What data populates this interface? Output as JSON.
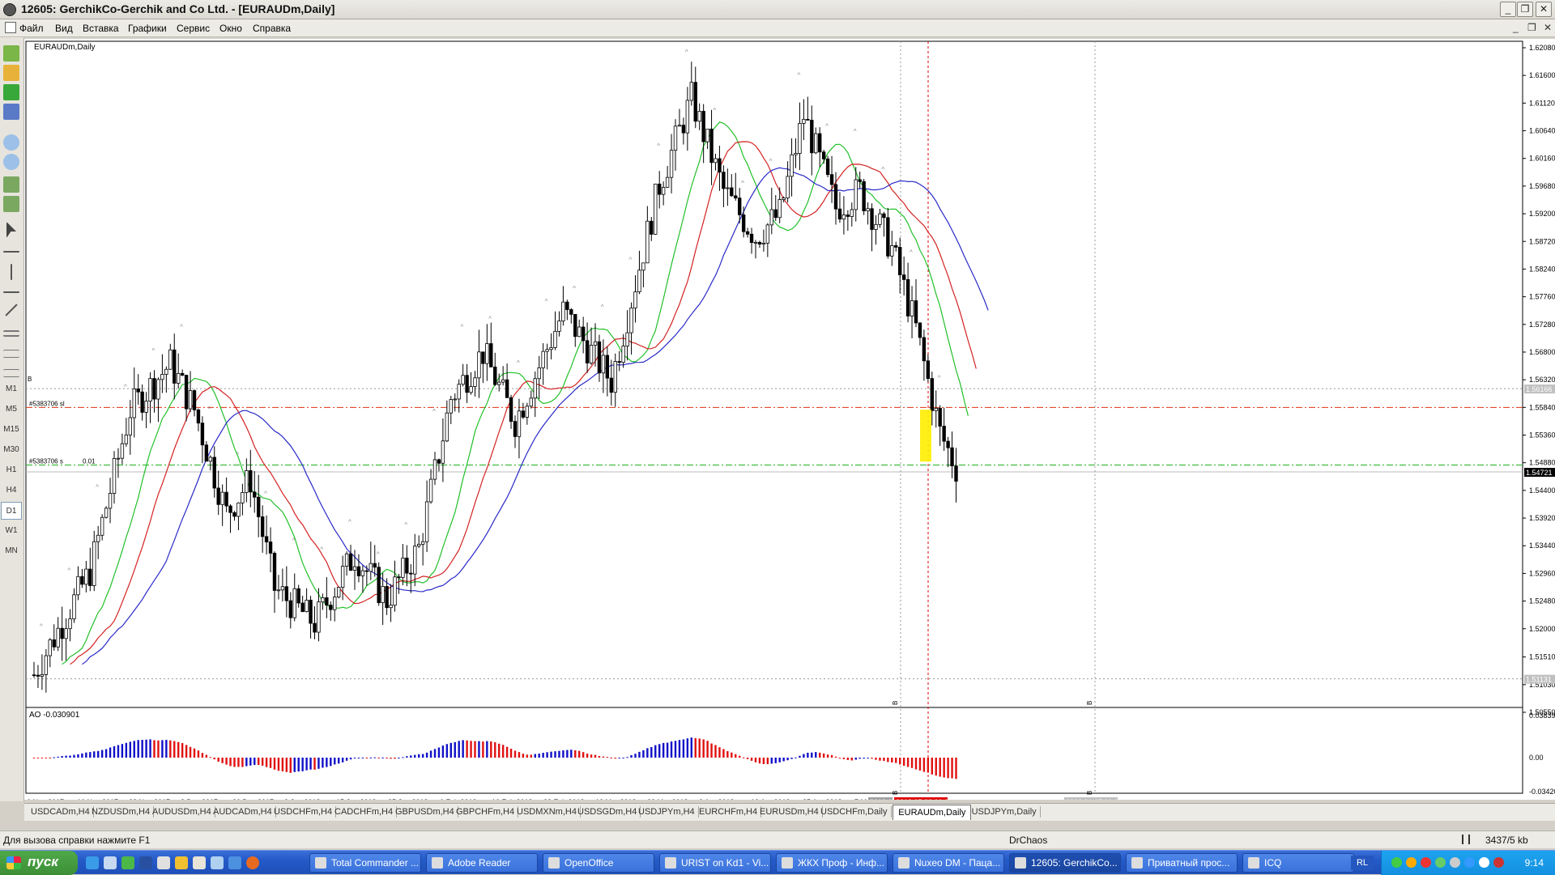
{
  "window": {
    "title": "12605: GerchikCo-Gerchik and Co Ltd. - [EURAUDm,Daily]",
    "min": "_",
    "max": "❐",
    "close": "✕"
  },
  "menu": [
    "Файл",
    "Вид",
    "Вставка",
    "Графики",
    "Сервис",
    "Окно",
    "Справка"
  ],
  "timeframes": [
    "M1",
    "M5",
    "M15",
    "M30",
    "H1",
    "H4",
    "D1",
    "W1",
    "MN"
  ],
  "active_timeframe": "D1",
  "chart": {
    "symbol_label": "EURAUDm,Daily",
    "price_ticks": [
      "1.62080",
      "1.61600",
      "1.61120",
      "1.60640",
      "1.60160",
      "1.59680",
      "1.59200",
      "1.58720",
      "1.58240",
      "1.57760",
      "1.57280",
      "1.56800",
      "1.56320",
      "1.55840",
      "1.55360",
      "1.54880",
      "1.54400",
      "1.53920",
      "1.53440",
      "1.52960",
      "1.52480",
      "1.52000",
      "1.51510",
      "1.51030",
      "1.50550"
    ],
    "price_min": 1.5055,
    "price_max": 1.6208,
    "bid_label": "1.54721",
    "level_label_upper": "1.56166",
    "level_label_lower": "1.51131",
    "order_label_1": "#5383706 sl",
    "order_label_2": "#5383706 s",
    "order_lot": "0.01",
    "order_marker": "B",
    "vline_marker": "B",
    "date_ticks": [
      "6 Nov 2017",
      "16 Nov 2017",
      "28 Nov 2017",
      "8 Dec 2017",
      "20 Dec 2017",
      "3 Jan 2018",
      "15 Jan 2018",
      "25 Jan 2018",
      "6 Feb 2018",
      "16 Feb 2018",
      "28 Feb 2018",
      "12 Mar 2018",
      "22 Mar 2018",
      "3 Apr 2018",
      "13 Apr 2018",
      "25 Apr 2018",
      "7 Ma"
    ],
    "date_highlight_1": "2018.0",
    "date_highlight_2": "2018.05.22 00:00",
    "date_highlight_3": "2018.06.17 00:00",
    "ao_label": "AO -0.030901",
    "ao_ticks": [
      "0.038395",
      "0.00",
      "-0.034201"
    ],
    "ma_colors": {
      "fast": "#22c02a",
      "mid": "#d42222",
      "slow": "#2a2ac8"
    },
    "ao_colors": {
      "up": "#1010c8",
      "down": "#e01010"
    },
    "highlight_color": "#ffee00"
  },
  "tabs": [
    "USDCADm,H4",
    "NZDUSDm,H4",
    "AUDUSDm,H4",
    "AUDCADm,H4",
    "USDCHFm,H4",
    "CADCHFm,H4",
    "GBPUSDm,H4",
    "GBPCHFm,H4",
    "USDMXNm,H4",
    "USDSGDm,H4",
    "USDJPYm,H4",
    "EURCHFm,H4",
    "EURUSDm,H4",
    "USDCHFm,Daily",
    "EURAUDm,Daily",
    "USDJPYm,Daily"
  ],
  "active_tab": "EURAUDm,Daily",
  "status": {
    "help": "Для вызова справки нажмите F1",
    "profile": "DrChaos",
    "traffic": "3437/5 kb"
  },
  "taskbar": {
    "start": "пуск",
    "tasks": [
      "Total Commander ...",
      "Adobe Reader",
      "OpenOffice",
      "URIST on Kd1 - Vi...",
      "ЖКХ Проф - Инф...",
      "Nuxeo DM - Паца...",
      "12605: GerchikCo...",
      "Приватный прос...",
      "ICQ"
    ],
    "active_task": "12605: GerchikCo...",
    "lang": "RL",
    "clock": "9:14"
  }
}
